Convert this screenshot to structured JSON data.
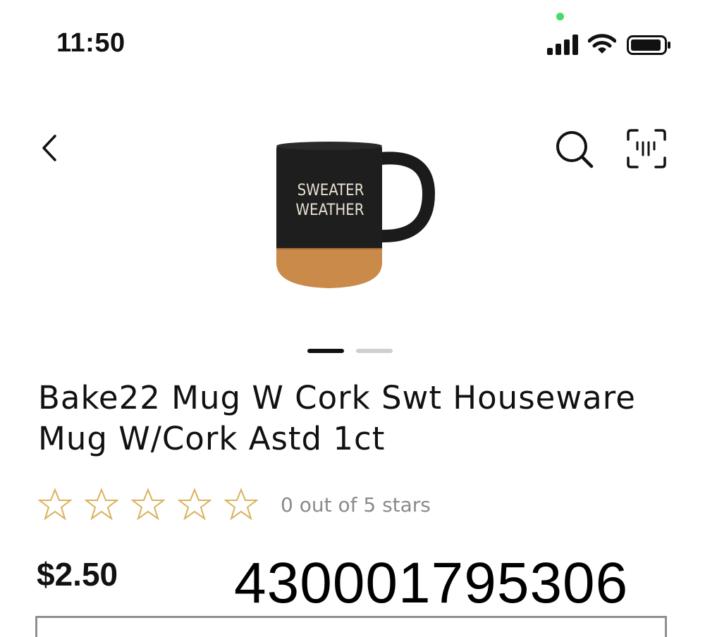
{
  "status_bar": {
    "time": "11:50",
    "privacy_indicator_color": "#4cd964",
    "icons": [
      "signal-icon",
      "wifi-icon",
      "battery-icon"
    ]
  },
  "header": {
    "back_icon": "chevron-left-icon",
    "search_icon": "search-icon",
    "scan_icon": "barcode-scan-icon"
  },
  "product": {
    "image_alt": "SWEATER WEATHER",
    "mug_text_line1": "SWEATER",
    "mug_text_line2": "WEATHER",
    "carousel": {
      "count": 2,
      "active_index": 0
    },
    "title": "Bake22 Mug W Cork Swt Houseware Mug W/Cork Astd 1ct",
    "rating": {
      "value": 0,
      "max": 5,
      "text": "0 out of 5 stars"
    },
    "price": "$2.50",
    "upc": "430001795306"
  },
  "colors": {
    "star_outline": "#d9b25c",
    "text_primary": "#111111",
    "text_secondary": "#8a8a8a",
    "dot_active": "#111111",
    "dot_inactive": "#cfcfcf"
  }
}
